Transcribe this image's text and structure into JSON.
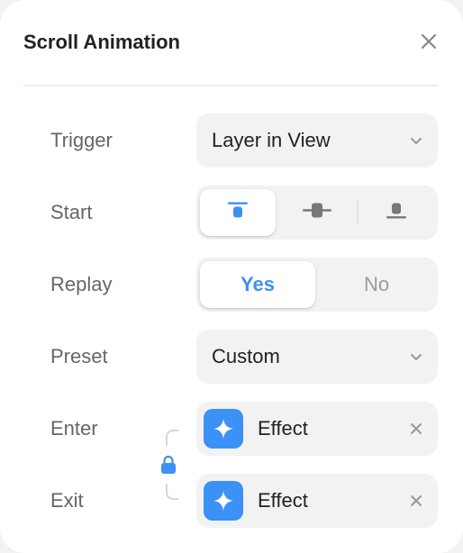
{
  "panel": {
    "title": "Scroll Animation"
  },
  "colors": {
    "accent": "#3b91f5",
    "label": "#666666",
    "field_bg": "#f2f2f2",
    "text": "#222222"
  },
  "rows": {
    "trigger": {
      "label": "Trigger",
      "value": "Layer in View",
      "icon": "chevron-down-icon"
    },
    "start": {
      "label": "Start",
      "options": [
        "align-top-icon",
        "align-center-icon",
        "align-bottom-icon"
      ],
      "selected": "align-top-icon"
    },
    "replay": {
      "label": "Replay",
      "yes": "Yes",
      "no": "No",
      "selected": "Yes"
    },
    "preset": {
      "label": "Preset",
      "value": "Custom",
      "icon": "chevron-down-icon"
    },
    "enter": {
      "label": "Enter",
      "effect": "Effect",
      "icon": "sparkle-icon"
    },
    "exit": {
      "label": "Exit",
      "effect": "Effect",
      "icon": "sparkle-icon"
    }
  },
  "link": {
    "icon": "lock-icon",
    "locked": true
  }
}
